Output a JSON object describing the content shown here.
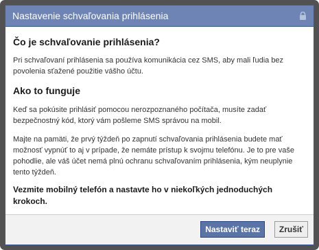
{
  "dialog": {
    "title": "Nastavenie schvaľovania prihlásenia",
    "heading1": "Čo je schvaľovanie prihlásenia?",
    "para1": "Pri schvaľovaní prihlásenia sa používa komunikácia cez SMS, aby mali ľudia bez povolenia sťažené použitie vášho účtu.",
    "heading2": "Ako to funguje",
    "para2": "Keď sa pokúsite prihlásiť pomocou nerozpoznaného počítača, musíte zadať bezpečnostný kód, ktorý vám pošleme SMS správou na mobil.",
    "para3": "Majte na pamäti, že prvý týždeň po zapnutí schvaľovania prihlásenia budete mať možnosť vypnúť to aj v prípade, že nemáte prístup k svojmu telefónu. Je to pre vaše pohodlie, ale váš účet nemá plnú ochranu schvaľovaním prihlásenia, kým neuplynie tento týždeň.",
    "bold_text": "Vezmite mobilný telefón a nastavte ho v niekoľkých jednoduchých krokoch.",
    "lock_icon": "lock-icon"
  },
  "buttons": {
    "setup_label": "Nastaviť teraz",
    "cancel_label": "Zrušiť"
  },
  "colors": {
    "titlebar": "#6d84b4",
    "primary_button": "#5b74a8"
  }
}
